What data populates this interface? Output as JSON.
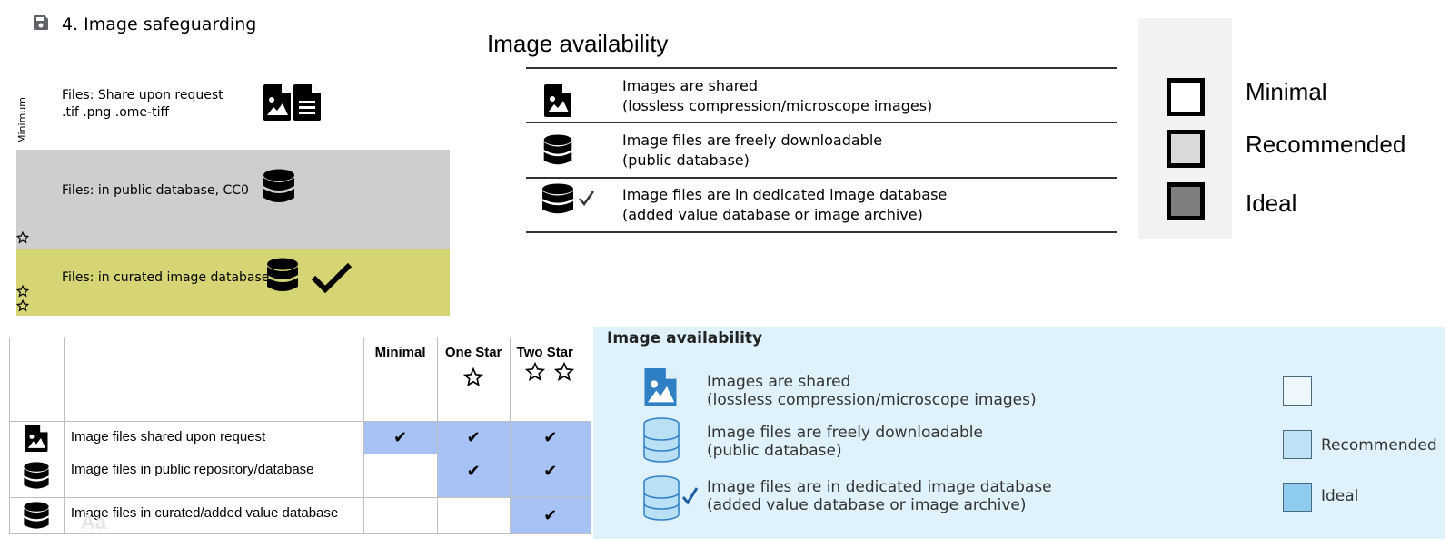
{
  "panel1": {
    "title": "4. Image safeguarding",
    "minimum_label": "Minimum",
    "row1": {
      "line1": "Files: Share upon request",
      "line2": ".tif .png .ome-tiff"
    },
    "row2": {
      "text": "Files: in public database, CC0",
      "color": "#cfcdce"
    },
    "row3": {
      "text": "Files: in curated image database",
      "color": "#d6d576"
    }
  },
  "panel2": {
    "title": "Image availability",
    "rows": [
      {
        "line1": "Images are shared",
        "line2": "(lossless compression/microscope images)",
        "icon": "image-file-icon"
      },
      {
        "line1": "Image files are freely downloadable",
        "line2": "(public database)",
        "icon": "database-icon"
      },
      {
        "line1": "Image files are in dedicated image database",
        "line2": "(added value database or image archive)",
        "icon": "database-check-icon"
      }
    ],
    "legend": [
      {
        "label": "Minimal",
        "color": "#ffffff"
      },
      {
        "label": "Recommended",
        "color": "#d9d9d9"
      },
      {
        "label": "Ideal",
        "color": "#7f7f7f"
      }
    ]
  },
  "panel3": {
    "columns": [
      "Minimal",
      "One Star",
      "Two Star"
    ],
    "rows": [
      {
        "icon": "image-file-icon",
        "label": "Image files shared upon request",
        "cells": [
          true,
          true,
          true
        ]
      },
      {
        "icon": "database-icon",
        "label": "Image files in public repository/database",
        "cells": [
          false,
          true,
          true
        ]
      },
      {
        "icon": "database-icon",
        "label": "Image files in curated/added value database",
        "cells": [
          false,
          false,
          true
        ]
      }
    ],
    "check": "✔",
    "watermark": "Aa",
    "highlight_color": "#a7c2f4"
  },
  "panel4": {
    "title": "Image availability",
    "rows": [
      {
        "line1": "Images are shared",
        "line2": "(lossless compression/microscope images)"
      },
      {
        "line1": "Image files are freely downloadable",
        "line2": "(public database)"
      },
      {
        "line1": "Image files are in dedicated image database",
        "line2": "(added value database or image archive)"
      }
    ],
    "legend": [
      {
        "label": "",
        "color": "#eef7fd"
      },
      {
        "label": "Recommended",
        "color": "#bde2f6"
      },
      {
        "label": "Ideal",
        "color": "#8ecbee"
      }
    ],
    "background": "#dff1fa"
  }
}
